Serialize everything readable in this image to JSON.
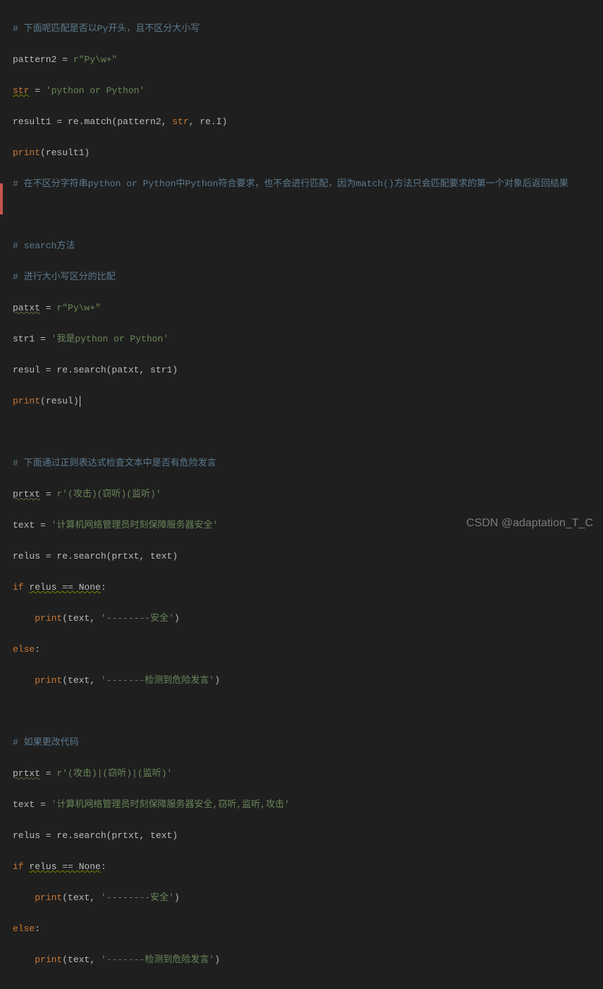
{
  "watermark": "CSDN @adaptation_T_C",
  "code": {
    "l1": "# 下面呢匹配是否以Py开头，且不区分大小写",
    "l2a": "pattern2",
    "l2b": " = ",
    "l2c": "r\"Py\\w+\"",
    "l3a": "str",
    "l3b": " = ",
    "l3c": "'python or Python'",
    "l4a": "result1 = re.match(pattern2, ",
    "l4b": "str",
    "l4c": ", re.I)",
    "l5a": "print",
    "l5b": "(result1)",
    "l6": "# 在不区分字符串python or Python中Python符合要求，也不会进行匹配，因为match()方法只会匹配要求的第一个对象后返回结果",
    "l8": "# search方法",
    "l9": "# 进行大小写区分的比配",
    "l10a": "patxt",
    "l10b": " = ",
    "l10c": "r\"Py\\w+\"",
    "l11a": "str1 = ",
    "l11b": "'我是python or Python'",
    "l12": "resul = re.search(patxt, str1)",
    "l13a": "print",
    "l13b": "(resul)",
    "l15": "# 下面通过正则表达式检查文本中是否有危险发言",
    "l16a": "prtxt",
    "l16b": " = ",
    "l16c": "r'(攻击)(窃听)(监听)'",
    "l17a": "text = ",
    "l17b": "'计算机网络管理员时刻保障服务器安全'",
    "l18": "relus = re.search(prtxt, text)",
    "l19a": "if ",
    "l19b": "relus == None",
    "l19c": ":",
    "l20a": "    ",
    "l20b": "print",
    "l20c": "(text, ",
    "l20d": "'--------安全'",
    "l20e": ")",
    "l21": "else",
    "l22a": "    ",
    "l22b": "print",
    "l22c": "(text, ",
    "l22d": "'-------检测到危险发言'",
    "l22e": ")",
    "l24": "# 如果更改代码",
    "l25a": "prtxt",
    "l25b": " = ",
    "l25c": "r'(攻击)|(窃听)|(监听)'",
    "l26a": "text = ",
    "l26b": "'计算机网络管理员时刻保障服务器安全,窃听,监听,攻击'",
    "l27": "relus = re.search(prtxt, text)",
    "l28a": "if ",
    "l28b": "relus == None",
    "l28c": ":",
    "l29a": "    ",
    "l29b": "print",
    "l29c": "(text, ",
    "l29d": "'--------安全'",
    "l29e": ")",
    "l30": "else",
    "l31a": "    ",
    "l31b": "print",
    "l31c": "(text, ",
    "l31d": "'-------检测到危险发言'",
    "l31e": ")"
  },
  "colors": {
    "background": "#1f1f1f",
    "comment": "#5c7a8e",
    "string": "#6a8759",
    "keyword": "#cc7832"
  }
}
